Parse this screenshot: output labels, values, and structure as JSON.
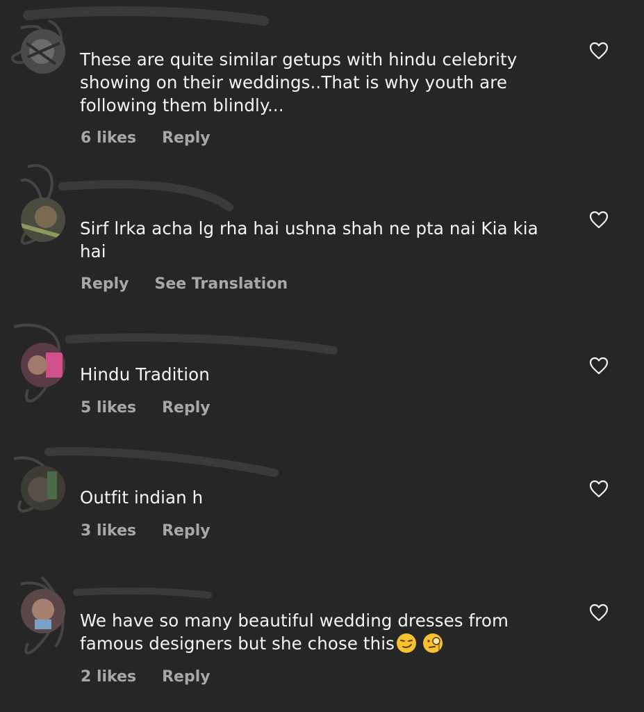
{
  "colors": {
    "background": "#262626",
    "text": "#f5f5f5",
    "muted": "#a8a8a8"
  },
  "comments": [
    {
      "text": "These are quite similar getups  with hindu celebrity showing on their weddings..That is why youth are following them blindly...",
      "likes": "6 likes",
      "reply": "Reply",
      "heart_icon": "heart-outline-icon"
    },
    {
      "text": "Sirf lrka acha lg rha hai ushna shah ne pta nai Kia kia hai",
      "reply": "Reply",
      "see_translation": "See Translation",
      "heart_icon": "heart-outline-icon"
    },
    {
      "text": "Hindu Tradition",
      "likes": "5 likes",
      "reply": "Reply",
      "heart_icon": "heart-outline-icon"
    },
    {
      "text": "Outfit indian h",
      "likes": "3 likes",
      "reply": "Reply",
      "heart_icon": "heart-outline-icon"
    },
    {
      "text": "We have so many beautiful wedding dresses from famous designers but she chose this",
      "likes": "2 likes",
      "reply": "Reply",
      "emojis": [
        "smirk-emoji",
        "monocle-emoji"
      ],
      "heart_icon": "heart-outline-icon"
    }
  ]
}
